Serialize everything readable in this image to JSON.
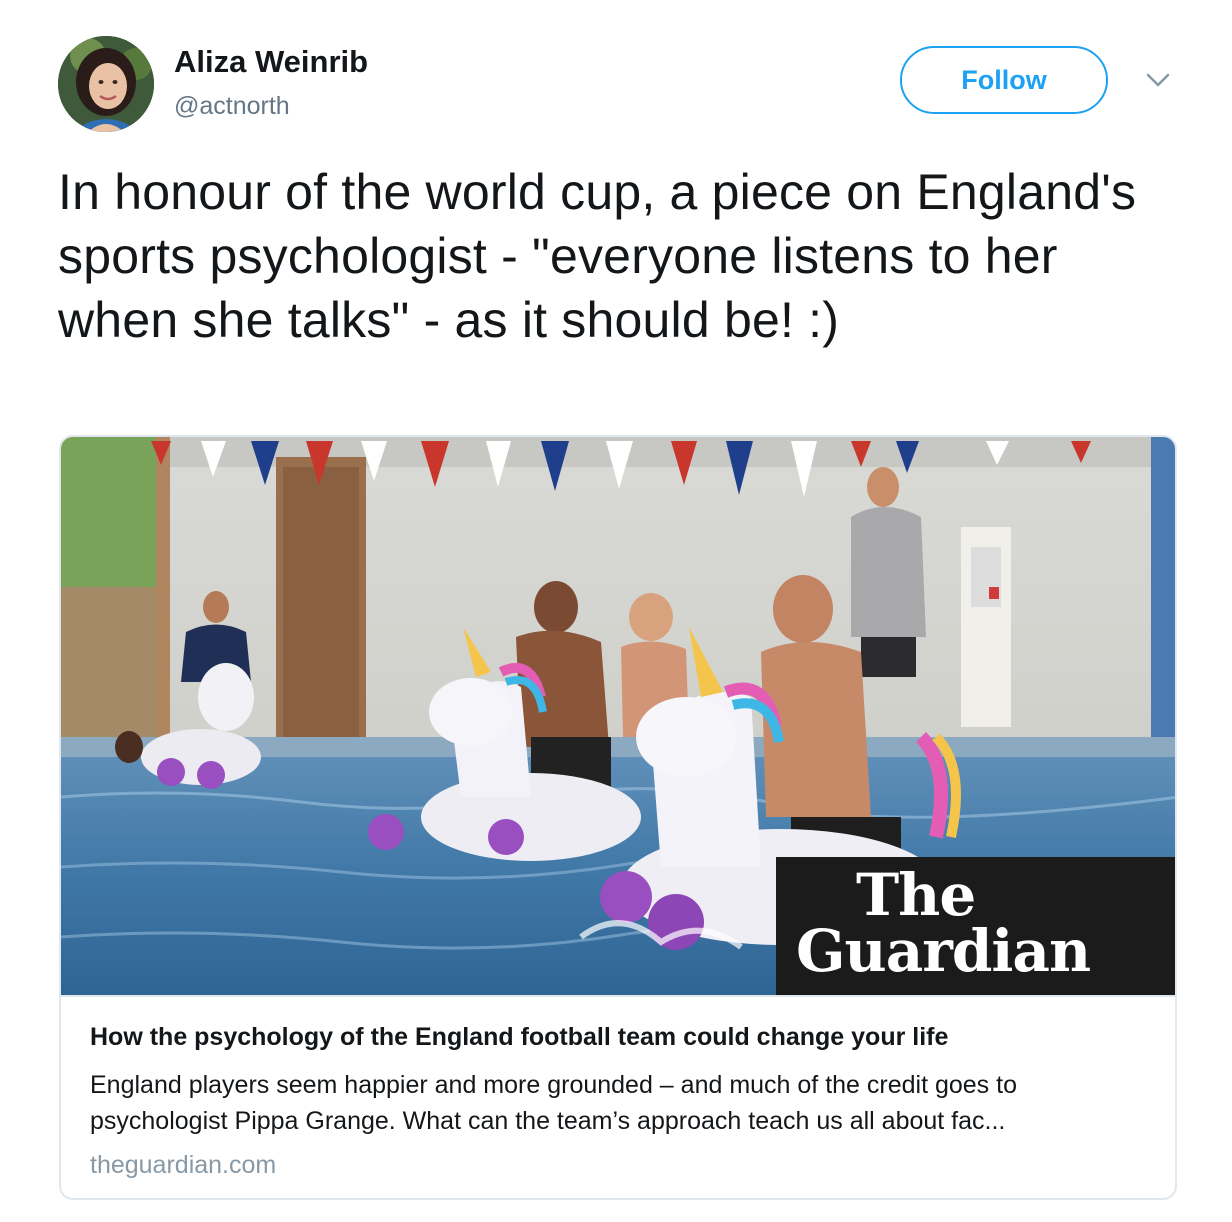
{
  "author": {
    "name": "Aliza Weinrib",
    "handle": "@actnorth",
    "avatar_icon": "avatar-photo"
  },
  "follow_button": {
    "label": "Follow",
    "color": "#1da1f2"
  },
  "menu_icon": "chevron-down-icon",
  "tweet": {
    "text": "In honour of the world cup, a piece on England's sports psychologist - \"everyone listens to her when she talks\" - as it should be! :)"
  },
  "card": {
    "image_icon": "pool-unicorn-photo",
    "logo_text_line1": "The",
    "logo_text_line2": "Guardian",
    "title": "How the psychology of the England football team could change your life",
    "description": "England players seem happier and more grounded – and much of the credit goes to psychologist Pippa Grange. What can the team’s approach teach us all about fac...",
    "domain": "theguardian.com"
  },
  "colors": {
    "text_primary": "#14171a",
    "text_secondary": "#657786",
    "domain_gray": "#8899a6",
    "border": "#e1e8ed",
    "accent": "#1da1f2"
  }
}
